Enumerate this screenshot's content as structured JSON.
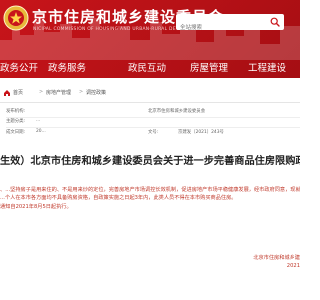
{
  "header": {
    "title": "京市住房和城乡建设委员会",
    "subtitle": "NICIPAL COMMISSION OF HOUSING AND URBAN-RURAL DEVELOPMENT",
    "search_placeholder": "全站搜索"
  },
  "nav": {
    "items": [
      "政务公开",
      "政务服务",
      "政民互动",
      "房屋管理",
      "工程建设"
    ]
  },
  "breadcrumb": {
    "items": [
      "首页",
      "房地产管理",
      "调控政策"
    ],
    "separator": ">"
  },
  "meta": {
    "row1": [
      "发布机构:",
      "北京市住房和城乡建设委员会"
    ],
    "row2": [
      "主题分类:",
      "..."
    ],
    "row3": [
      "成文日期:",
      "20...",
      "文号:",
      "京建发〔2021〕243号",
      "",
      ""
    ]
  },
  "article": {
    "title": "生效）北京市住房和城乡建设委员会关于进一步完善商品住房限购政策的公",
    "paragraphs": [
      "、...坚持房子是用来住的、不是用来炒的定位，完善房地产市场调控长效机制，促进房地产市场平稳健康发展，经市政府同意，现就有关事项",
      "...个人在本市各方面均不具备购房资格，自政策实施之日起3年内，此类人员不得在本市购买商品住房。",
      "通知自2021年8月5日起执行。"
    ]
  },
  "signature": {
    "org": "北京市住房和城乡建",
    "date": "2021"
  },
  "colors": {
    "brand_red": "#c8141a",
    "body_red": "#c0392b"
  }
}
